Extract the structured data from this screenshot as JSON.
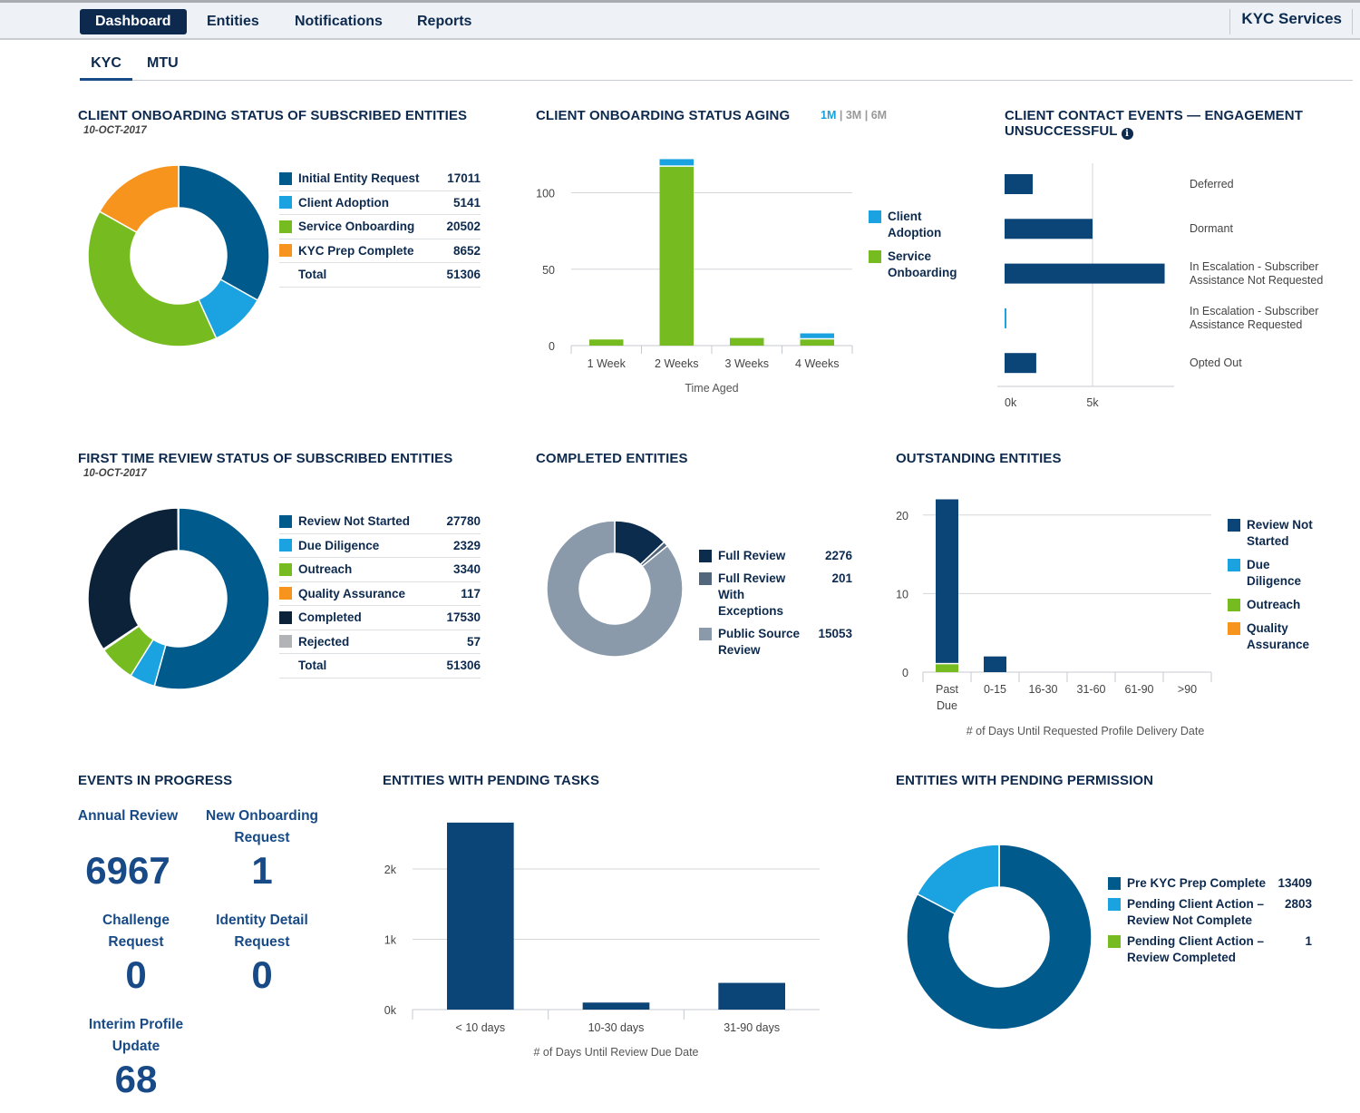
{
  "topnav": {
    "items": [
      "Dashboard",
      "Entities",
      "Notifications",
      "Reports"
    ],
    "active": "Dashboard",
    "brand": "KYC Services"
  },
  "subtabs": {
    "items": [
      "KYC",
      "MTU"
    ],
    "active": "KYC"
  },
  "colors": {
    "navy": "#0d2a4e",
    "blue": "#005a8c",
    "darkblue": "#0b4477",
    "cyan": "#1aa3e0",
    "green": "#76bc21",
    "orange": "#f7941d",
    "black_navy": "#0c2238",
    "gray": "#b1b3b6",
    "slate": "#8a9aab",
    "slate_dark": "#52667c"
  },
  "onboarding_status": {
    "title": "CLIENT ONBOARDING STATUS OF SUBSCRIBED ENTITIES",
    "date": "10-OCT-2017",
    "total_label": "Total",
    "total_value": "51306"
  },
  "aging": {
    "title": "CLIENT ONBOARDING STATUS AGING",
    "ranges": [
      "1M",
      "3M",
      "6M"
    ],
    "active_range": "1M"
  },
  "contact_events": {
    "title": "CLIENT CONTACT EVENTS — ENGAGEMENT UNSUCCESSFUL",
    "title_line1": "CLIENT CONTACT EVENTS — ENGAGEMENT",
    "title_line2": "UNSUCCESSFUL",
    "info_icon": "info-icon"
  },
  "first_review": {
    "title": "FIRST TIME REVIEW STATUS OF SUBSCRIBED ENTITIES",
    "date": "10-OCT-2017",
    "total_label": "Total",
    "total_value": "51306"
  },
  "completed": {
    "title": "COMPLETED ENTITIES"
  },
  "outstanding": {
    "title": "OUTSTANDING ENTITIES"
  },
  "events": {
    "title": "EVENTS IN PROGRESS",
    "items": [
      {
        "label_lines": [
          "Annual Review"
        ],
        "value": "6967"
      },
      {
        "label_lines": [
          "New Onboarding",
          "Request"
        ],
        "value": "1"
      },
      {
        "label_lines": [
          "Challenge",
          "Request"
        ],
        "value": "0"
      },
      {
        "label_lines": [
          "Identity Detail",
          "Request"
        ],
        "value": "0"
      },
      {
        "label_lines": [
          "Interim Profile",
          "Update"
        ],
        "value": "68"
      }
    ]
  },
  "pending_tasks": {
    "title": "ENTITIES WITH PENDING TASKS"
  },
  "pending_permission": {
    "title": "ENTITIES WITH PENDING PERMISSION"
  },
  "chart_data": [
    {
      "id": "onboarding_status",
      "type": "pie",
      "donut": true,
      "title": "CLIENT ONBOARDING STATUS OF SUBSCRIBED ENTITIES",
      "labels": [
        "Initial Entity Request",
        "Client Adoption",
        "Service Onboarding",
        "KYC Prep Complete"
      ],
      "values": [
        17011,
        5141,
        20502,
        8652
      ],
      "colors": [
        "#005a8c",
        "#1aa3e0",
        "#76bc21",
        "#f7941d"
      ],
      "total": 51306,
      "legend": "right"
    },
    {
      "id": "aging",
      "type": "bar",
      "stacked": true,
      "title": "CLIENT ONBOARDING STATUS AGING",
      "categories": [
        "1 Week",
        "2 Weeks",
        "3 Weeks",
        "4 Weeks"
      ],
      "series": [
        {
          "name": "Service Onboarding",
          "values": [
            4,
            117,
            5,
            4
          ],
          "color": "#76bc21"
        },
        {
          "name": "Client Adoption",
          "values": [
            0,
            5,
            0,
            4
          ],
          "color": "#1aa3e0"
        }
      ],
      "legend_order": [
        "Client Adoption",
        "Service Onboarding"
      ],
      "xlabel": "Time Aged",
      "ylabel": "",
      "yticks": [
        0,
        50,
        100
      ],
      "ylim": [
        0,
        125
      ],
      "grid": true,
      "legend": "right"
    },
    {
      "id": "contact_events",
      "type": "bar",
      "orientation": "horizontal",
      "title": "CLIENT CONTACT EVENTS — ENGAGEMENT UNSUCCESSFUL",
      "categories": [
        "Deferred",
        "Dormant",
        "In Escalation - Subscriber Assistance Not Requested",
        "In Escalation - Subscriber Assistance Requested",
        "Opted Out"
      ],
      "category_lines": [
        [
          "Deferred"
        ],
        [
          "Dormant"
        ],
        [
          "In Escalation - Subscriber",
          "Assistance Not Requested"
        ],
        [
          "In Escalation - Subscriber",
          "Assistance Requested"
        ],
        [
          "Opted Out"
        ]
      ],
      "values": [
        1600,
        5000,
        9100,
        100,
        1800
      ],
      "colors": [
        "#0b4477",
        "#0b4477",
        "#0b4477",
        "#1aa3e0",
        "#0b4477"
      ],
      "xticks": [
        "0k",
        "5k"
      ],
      "xtick_values": [
        0,
        5000
      ],
      "xlim": [
        0,
        10000
      ],
      "grid": true
    },
    {
      "id": "first_review",
      "type": "pie",
      "donut": true,
      "title": "FIRST TIME REVIEW STATUS OF SUBSCRIBED ENTITIES",
      "labels": [
        "Review Not Started",
        "Due Diligence",
        "Outreach",
        "Quality Assurance",
        "Completed",
        "Rejected"
      ],
      "values": [
        27780,
        2329,
        3340,
        117,
        17530,
        57
      ],
      "colors": [
        "#005a8c",
        "#1aa3e0",
        "#76bc21",
        "#f7941d",
        "#0c2238",
        "#b1b3b6"
      ],
      "total": 51306,
      "legend": "right"
    },
    {
      "id": "completed",
      "type": "pie",
      "donut": true,
      "title": "COMPLETED ENTITIES",
      "labels": [
        "Full Review",
        "Full Review With Exceptions",
        "Public Source Review"
      ],
      "label_lines": [
        [
          "Full Review"
        ],
        [
          "Full Review",
          "With",
          "Exceptions"
        ],
        [
          "Public Source",
          "Review"
        ]
      ],
      "values": [
        2276,
        201,
        15053
      ],
      "colors": [
        "#0c2c4e",
        "#52667c",
        "#8a9aab"
      ],
      "legend": "right"
    },
    {
      "id": "outstanding",
      "type": "bar",
      "stacked": true,
      "title": "OUTSTANDING ENTITIES",
      "categories": [
        "Past Due",
        "0-15",
        "16-30",
        "31-60",
        "61-90",
        ">90"
      ],
      "category_lines": [
        [
          "Past",
          "Due"
        ],
        [
          "0-15"
        ],
        [
          "16-30"
        ],
        [
          "31-60"
        ],
        [
          "61-90"
        ],
        [
          ">90"
        ]
      ],
      "series": [
        {
          "name": "Outreach",
          "values": [
            1,
            0,
            0,
            0,
            0,
            0
          ],
          "color": "#76bc21"
        },
        {
          "name": "Review Not Started",
          "values": [
            21,
            2,
            0,
            0,
            0,
            0
          ],
          "color": "#0b4477"
        },
        {
          "name": "Due Diligence",
          "values": [
            0,
            0,
            0,
            0,
            0,
            0
          ],
          "color": "#1aa3e0"
        },
        {
          "name": "Quality Assurance",
          "values": [
            0,
            0,
            0,
            0,
            0,
            0
          ],
          "color": "#f7941d"
        }
      ],
      "legend_order": [
        "Review Not Started",
        "Due Diligence",
        "Outreach",
        "Quality Assurance"
      ],
      "legend_lines": [
        [
          "Review Not",
          "Started"
        ],
        [
          "Due",
          "Diligence"
        ],
        [
          "Outreach"
        ],
        [
          "Quality",
          "Assurance"
        ]
      ],
      "xlabel": "# of Days Until Requested Profile Delivery Date",
      "yticks": [
        0,
        10,
        20
      ],
      "ylim": [
        0,
        22
      ],
      "grid": true,
      "legend": "right"
    },
    {
      "id": "pending_tasks",
      "type": "bar",
      "title": "ENTITIES WITH PENDING TASKS",
      "categories": [
        "< 10 days",
        "10-30 days",
        "31-90 days"
      ],
      "values": [
        2660,
        100,
        380
      ],
      "color": "#0b4477",
      "xlabel": "# of Days Until Review Due Date",
      "yticks": [
        "0k",
        "1k",
        "2k"
      ],
      "ytick_values": [
        0,
        1000,
        2000
      ],
      "ylim": [
        0,
        2660
      ],
      "grid": true
    },
    {
      "id": "pending_permission",
      "type": "pie",
      "donut": true,
      "title": "ENTITIES WITH PENDING PERMISSION",
      "labels": [
        "Pre KYC Prep Complete",
        "Pending Client Action – Review Not Complete",
        "Pending Client Action – Review Completed"
      ],
      "label_lines": [
        [
          "Pre KYC Prep Complete"
        ],
        [
          "Pending Client Action –",
          "Review Not Complete"
        ],
        [
          "Pending Client Action –",
          "Review Completed"
        ]
      ],
      "values": [
        13409,
        2803,
        1
      ],
      "colors": [
        "#005a8c",
        "#1aa3e0",
        "#76bc21"
      ],
      "legend": "right"
    }
  ]
}
